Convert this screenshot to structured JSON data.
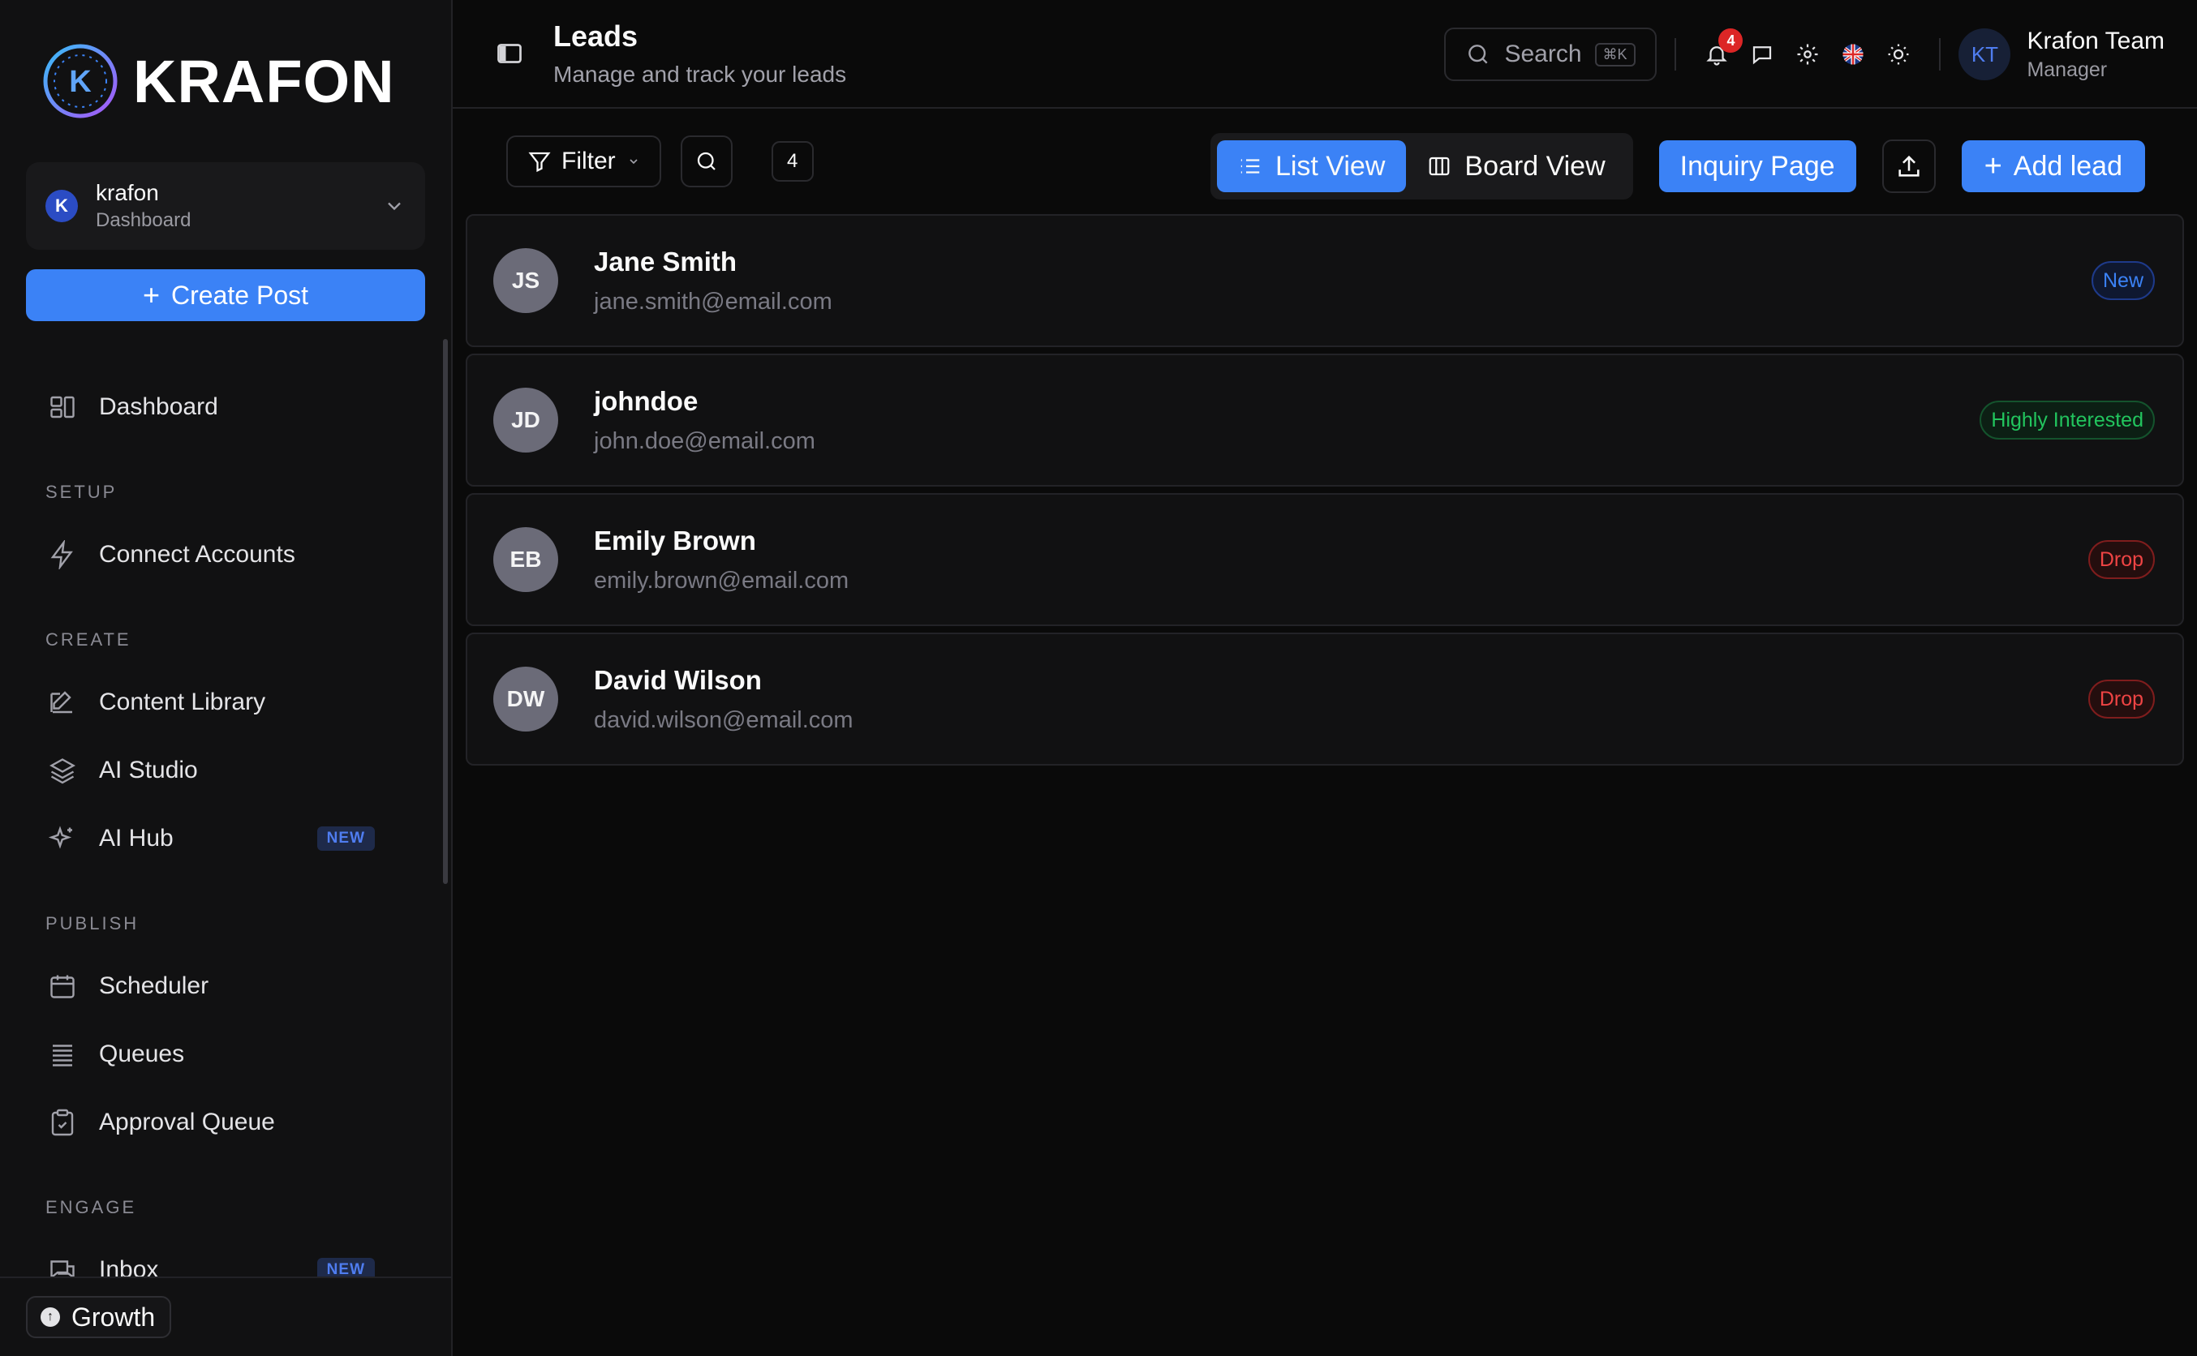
{
  "brand": {
    "name": "KRAFON",
    "mark_letter": "K"
  },
  "workspace": {
    "avatar": "K",
    "name": "krafon",
    "subtitle": "Dashboard"
  },
  "sidebar": {
    "create_label": "Create Post",
    "dashboard": "Dashboard",
    "sections": {
      "setup": "SETUP",
      "create": "CREATE",
      "publish": "PUBLISH",
      "engage": "ENGAGE"
    },
    "items": {
      "connect_accounts": "Connect Accounts",
      "content_library": "Content Library",
      "ai_studio": "AI Studio",
      "ai_hub": "AI Hub",
      "scheduler": "Scheduler",
      "queues": "Queues",
      "approval_queue": "Approval Queue",
      "inbox": "Inbox"
    },
    "new_badge": "NEW",
    "plan": "Growth"
  },
  "header": {
    "title": "Leads",
    "subtitle": "Manage and track your leads",
    "search_placeholder": "Search",
    "search_shortcut": "⌘K",
    "notification_count": "4",
    "user": {
      "initials": "KT",
      "name": "Krafon Team",
      "role": "Manager"
    }
  },
  "toolbar": {
    "filter_label": "Filter",
    "lead_count": "4",
    "list_view": "List View",
    "board_view": "Board View",
    "inquiry_page": "Inquiry Page",
    "add_lead": "Add lead"
  },
  "leads": [
    {
      "initials": "JS",
      "name": "Jane Smith",
      "email": "jane.smith@email.com",
      "status": "New",
      "status_kind": "new"
    },
    {
      "initials": "JD",
      "name": "johndoe",
      "email": "john.doe@email.com",
      "status": "Highly Interested",
      "status_kind": "hi"
    },
    {
      "initials": "EB",
      "name": "Emily Brown",
      "email": "emily.brown@email.com",
      "status": "Drop",
      "status_kind": "drop"
    },
    {
      "initials": "DW",
      "name": "David Wilson",
      "email": "david.wilson@email.com",
      "status": "Drop",
      "status_kind": "drop"
    }
  ],
  "colors": {
    "accent": "#3b82f6",
    "status_new": "#3b82f6",
    "status_highly_interested": "#22c55e",
    "status_drop": "#ef4444",
    "notification": "#dc2626"
  }
}
